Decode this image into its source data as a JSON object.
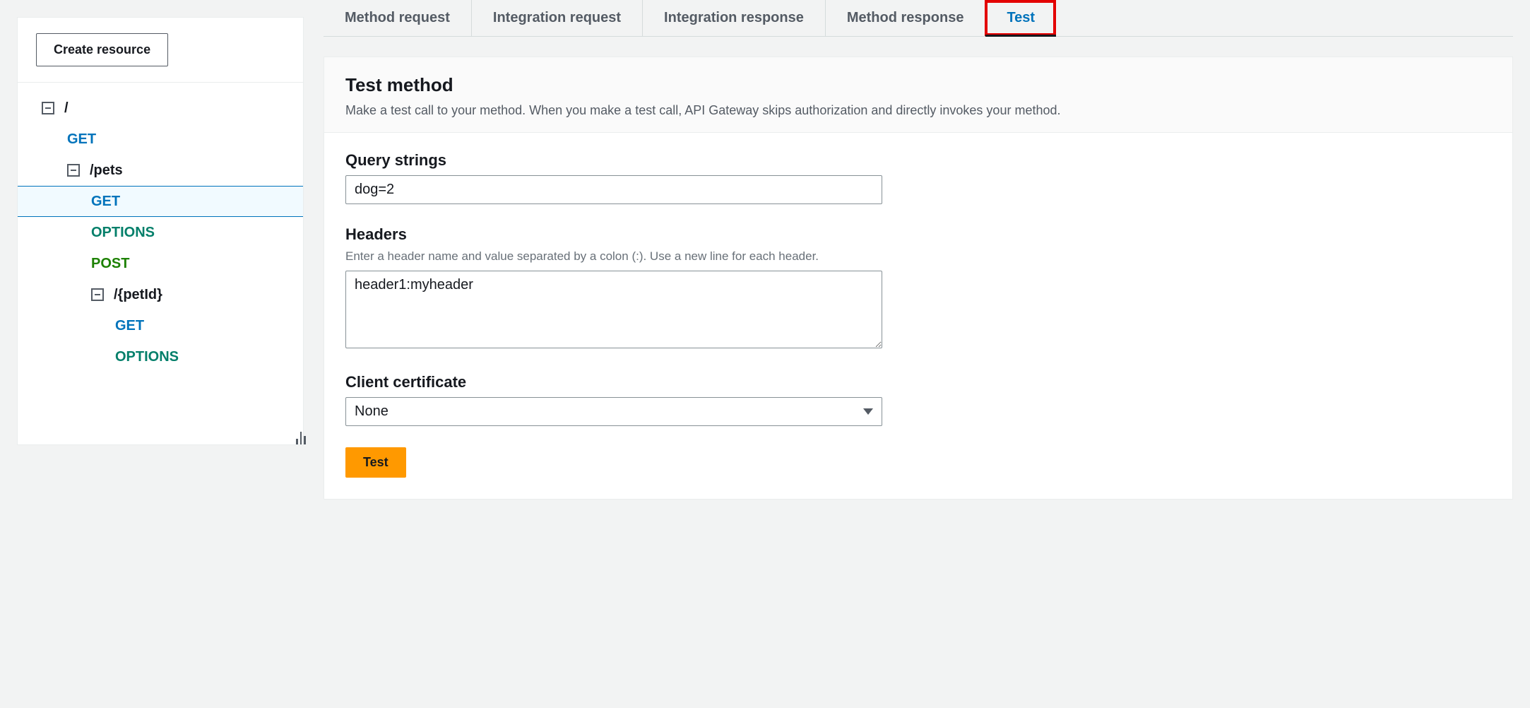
{
  "sidebar": {
    "create_label": "Create resource",
    "tree": {
      "root_label": "/",
      "root_get": "GET",
      "pets_label": "/pets",
      "pets_get": "GET",
      "pets_options": "OPTIONS",
      "pets_post": "POST",
      "petid_label": "/{petId}",
      "petid_get": "GET",
      "petid_options": "OPTIONS"
    }
  },
  "tabs": {
    "method_request": "Method request",
    "integration_request": "Integration request",
    "integration_response": "Integration response",
    "method_response": "Method response",
    "test": "Test"
  },
  "panel": {
    "title": "Test method",
    "description": "Make a test call to your method. When you make a test call, API Gateway skips authorization and directly invokes your method."
  },
  "form": {
    "query_label": "Query strings",
    "query_value": "dog=2",
    "headers_label": "Headers",
    "headers_hint": "Enter a header name and value separated by a colon (:). Use a new line for each header.",
    "headers_value": "header1:myheader",
    "cert_label": "Client certificate",
    "cert_value": "None",
    "test_button": "Test"
  }
}
